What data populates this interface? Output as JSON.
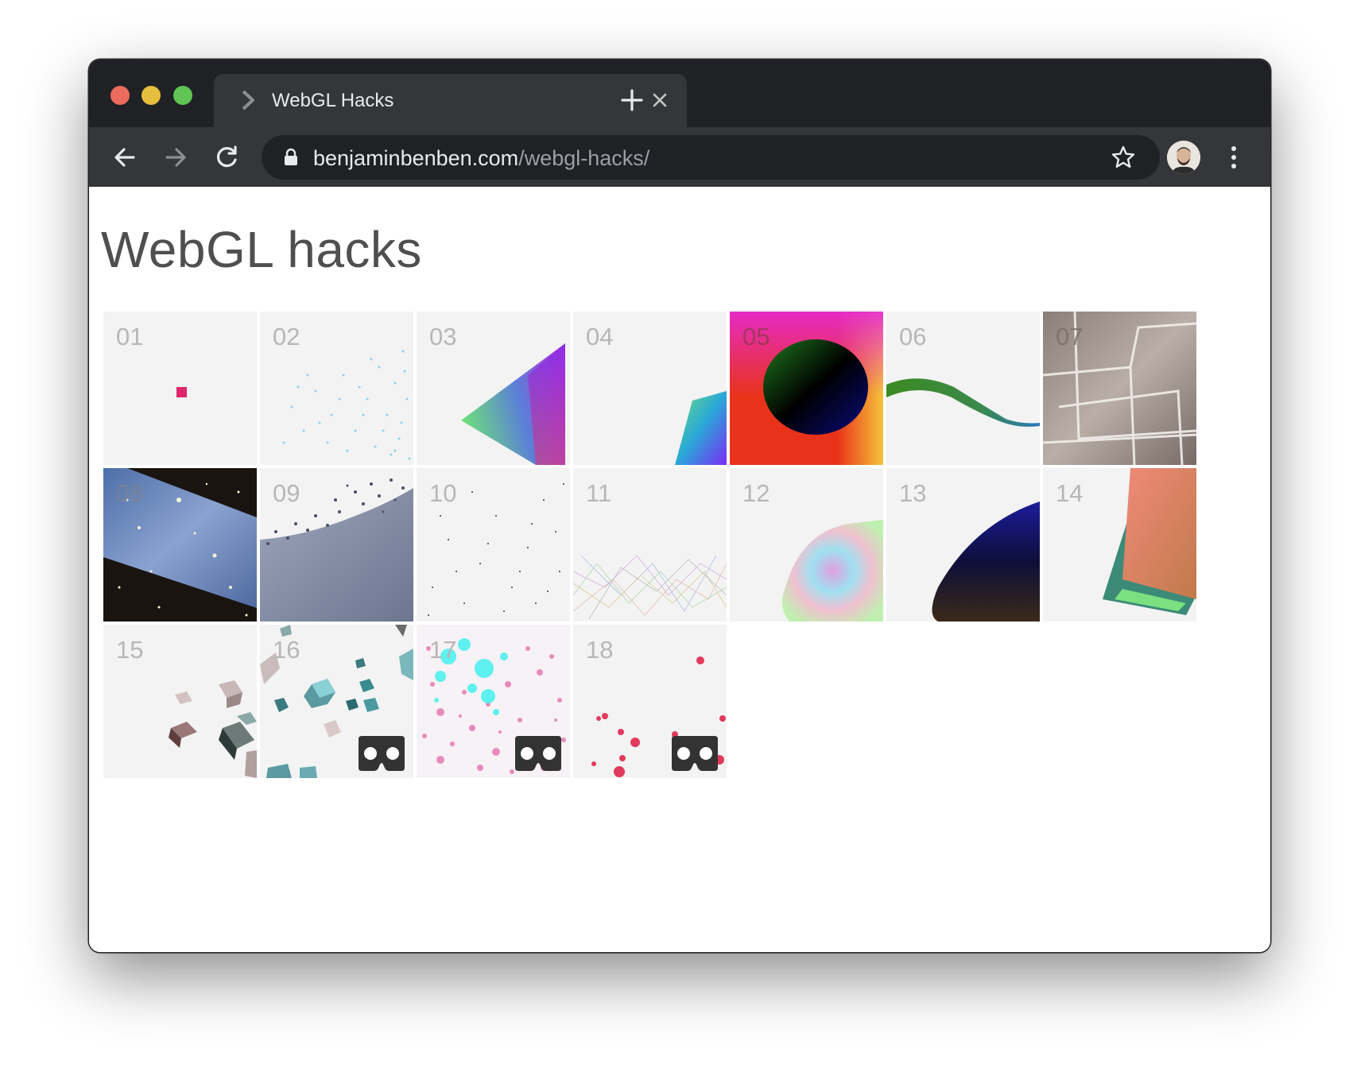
{
  "browser": {
    "tab_title": "WebGL Hacks",
    "url_host": "benjaminbenben.com",
    "url_path": "/webgl-hacks/"
  },
  "page": {
    "title": "WebGL hacks"
  },
  "tiles": [
    {
      "number": "01",
      "vr": false
    },
    {
      "number": "02",
      "vr": false
    },
    {
      "number": "03",
      "vr": false
    },
    {
      "number": "04",
      "vr": false
    },
    {
      "number": "05",
      "vr": false
    },
    {
      "number": "06",
      "vr": false
    },
    {
      "number": "07",
      "vr": false
    },
    {
      "number": "08",
      "vr": false
    },
    {
      "number": "09",
      "vr": false
    },
    {
      "number": "10",
      "vr": false
    },
    {
      "number": "11",
      "vr": false
    },
    {
      "number": "12",
      "vr": false
    },
    {
      "number": "13",
      "vr": false
    },
    {
      "number": "14",
      "vr": false
    },
    {
      "number": "15",
      "vr": false
    },
    {
      "number": "16",
      "vr": true
    },
    {
      "number": "17",
      "vr": true
    },
    {
      "number": "18",
      "vr": true
    }
  ],
  "colors": {
    "titlebar": "#202124",
    "toolbar": "#35363a",
    "tile_bg": "#f3f3f3",
    "tile_number": "#b7b7b7",
    "title_text": "#4f4f4f"
  }
}
